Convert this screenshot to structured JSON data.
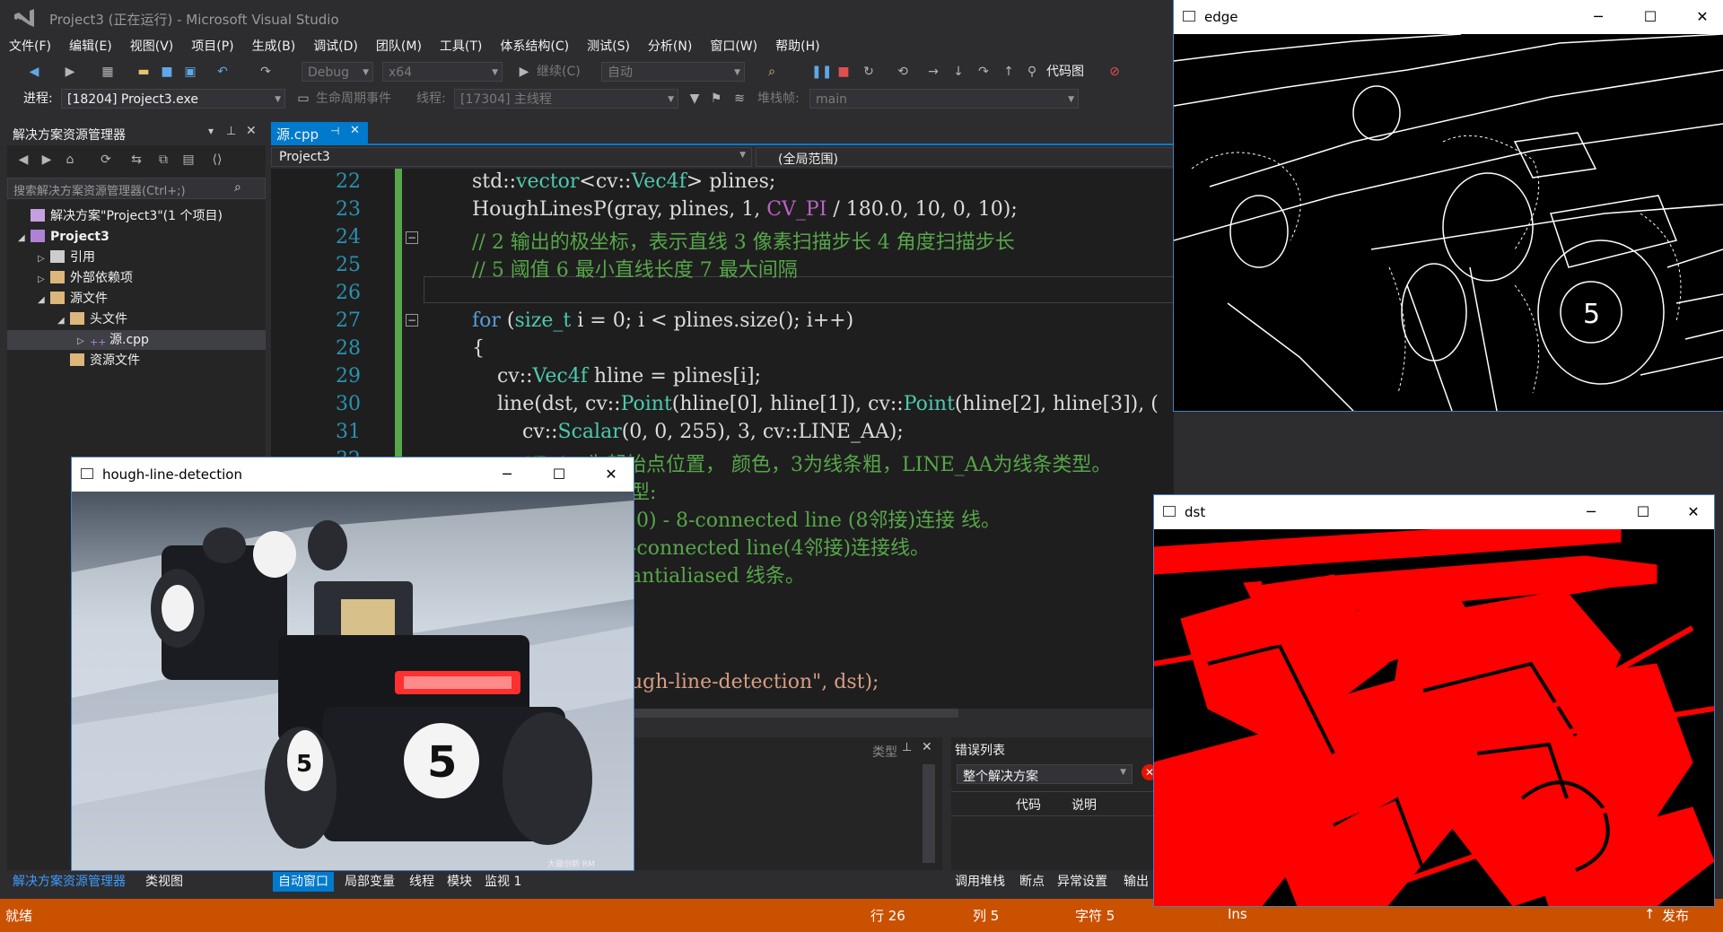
{
  "titlebar": {
    "title": "Project3 (正在运行) - Microsoft Visual Studio"
  },
  "menu": [
    "文件(F)",
    "编辑(E)",
    "视图(V)",
    "项目(P)",
    "生成(B)",
    "调试(D)",
    "团队(M)",
    "工具(T)",
    "体系结构(C)",
    "测试(S)",
    "分析(N)",
    "窗口(W)",
    "帮助(H)"
  ],
  "toolbar1": {
    "config": "Debug",
    "platform": "x64",
    "continue": "继续(C)",
    "auto": "自动",
    "codemap": "代码图"
  },
  "toolbar2": {
    "process_label": "进程:",
    "process": "[18204] Project3.exe",
    "lifecycle": "生命周期事件",
    "thread_label": "线程:",
    "thread": "[17304] 主线程",
    "stackframe_label": "堆栈帧:",
    "stackframe": "main"
  },
  "solution_explorer": {
    "title": "解决方案资源管理器",
    "search_placeholder": "搜索解决方案资源管理器(Ctrl+;)",
    "items": [
      {
        "label": "解决方案\"Project3\"(1 个项目)"
      },
      {
        "label": "Project3"
      },
      {
        "label": "引用"
      },
      {
        "label": "外部依赖项"
      },
      {
        "label": "源文件"
      },
      {
        "label": "头文件"
      },
      {
        "label": "源.cpp"
      },
      {
        "label": "资源文件"
      }
    ]
  },
  "editor": {
    "tab": "源.cpp",
    "project_combo": "Project3",
    "scope_combo": "(全局范围)",
    "line_numbers": [
      "22",
      "23",
      "24",
      "25",
      "26",
      "27",
      "28",
      "29",
      "30",
      "31",
      "32"
    ],
    "visible_fragments": {
      "l32": "//Point为起始点位置， 颜色，3为线条粗，LINE_AA为线条类型。",
      "l33": "型:",
      "l34": " 0) - 8-connected line (8邻接)连接 线。",
      "l35": "-connected line(4邻接)连接线。",
      "l36": "antialiased 线条。",
      "l37": "ugh-line-detection\", dst);"
    }
  },
  "windows": {
    "hough": {
      "title": "hough-line-detection",
      "watermark": "大疆创新 RM"
    },
    "edge": {
      "title": "edge"
    },
    "dst": {
      "title": "dst"
    }
  },
  "panels": {
    "auto_window_col": "类型",
    "error_list_title": "错误列表",
    "error_scope": "整个解决方案",
    "error_cols": [
      "代码",
      "说明"
    ]
  },
  "bottom_tabs_left": [
    "解决方案资源管理器",
    "类视图"
  ],
  "bottom_tabs_mid": [
    "自动窗口",
    "局部变量",
    "线程",
    "模块",
    "监视 1"
  ],
  "bottom_tabs_right": [
    "调用堆栈",
    "断点",
    "异常设置",
    "输出"
  ],
  "statusbar": {
    "ready": "就绪",
    "row": "行 26",
    "col": "列 5",
    "char": "字符 5",
    "ins": "Ins",
    "publish": "发布"
  },
  "colors": {
    "accent": "#007acc",
    "status": "#ca5100",
    "editor_bg": "#1e1e1e",
    "dst_lines": "#ff0000"
  }
}
